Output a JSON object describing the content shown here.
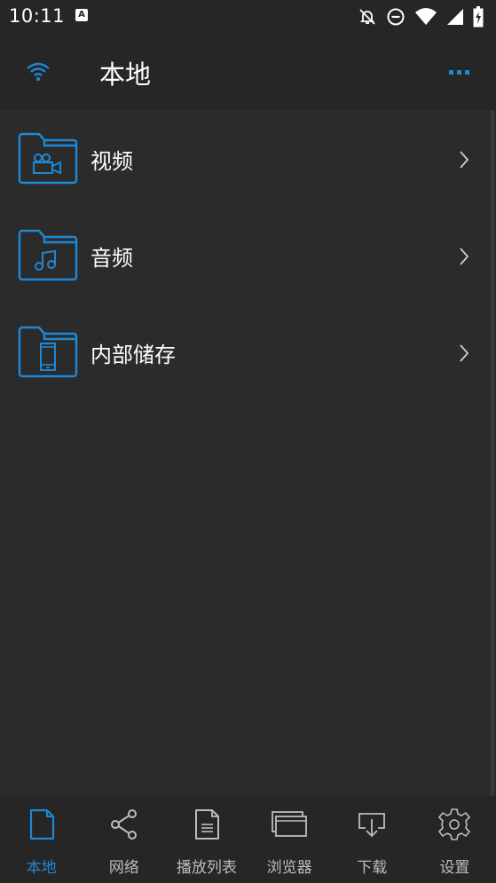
{
  "status_bar": {
    "time": "10:11",
    "notification_icon": "a-app-icon",
    "icons": [
      "bell-off-icon",
      "do-not-disturb-icon",
      "wifi-signal-icon",
      "cell-signal-icon",
      "battery-charging-icon"
    ]
  },
  "app_bar": {
    "title": "本地",
    "left_icon": "wifi-icon",
    "right_icon": "more-icon"
  },
  "list": {
    "items": [
      {
        "label": "视频",
        "icon": "video-folder-icon"
      },
      {
        "label": "音频",
        "icon": "music-folder-icon"
      },
      {
        "label": "内部储存",
        "icon": "phone-folder-icon"
      }
    ]
  },
  "bottom_nav": {
    "active_index": 0,
    "items": [
      {
        "label": "本地",
        "icon": "file-icon"
      },
      {
        "label": "网络",
        "icon": "share-icon"
      },
      {
        "label": "播放列表",
        "icon": "document-list-icon"
      },
      {
        "label": "浏览器",
        "icon": "windows-icon"
      },
      {
        "label": "下载",
        "icon": "download-icon"
      },
      {
        "label": "设置",
        "icon": "gear-icon"
      }
    ]
  },
  "colors": {
    "accent": "#1e88d4",
    "background": "#2b2b2b",
    "bar_background": "#262626",
    "inactive": "#bdbdbd"
  }
}
